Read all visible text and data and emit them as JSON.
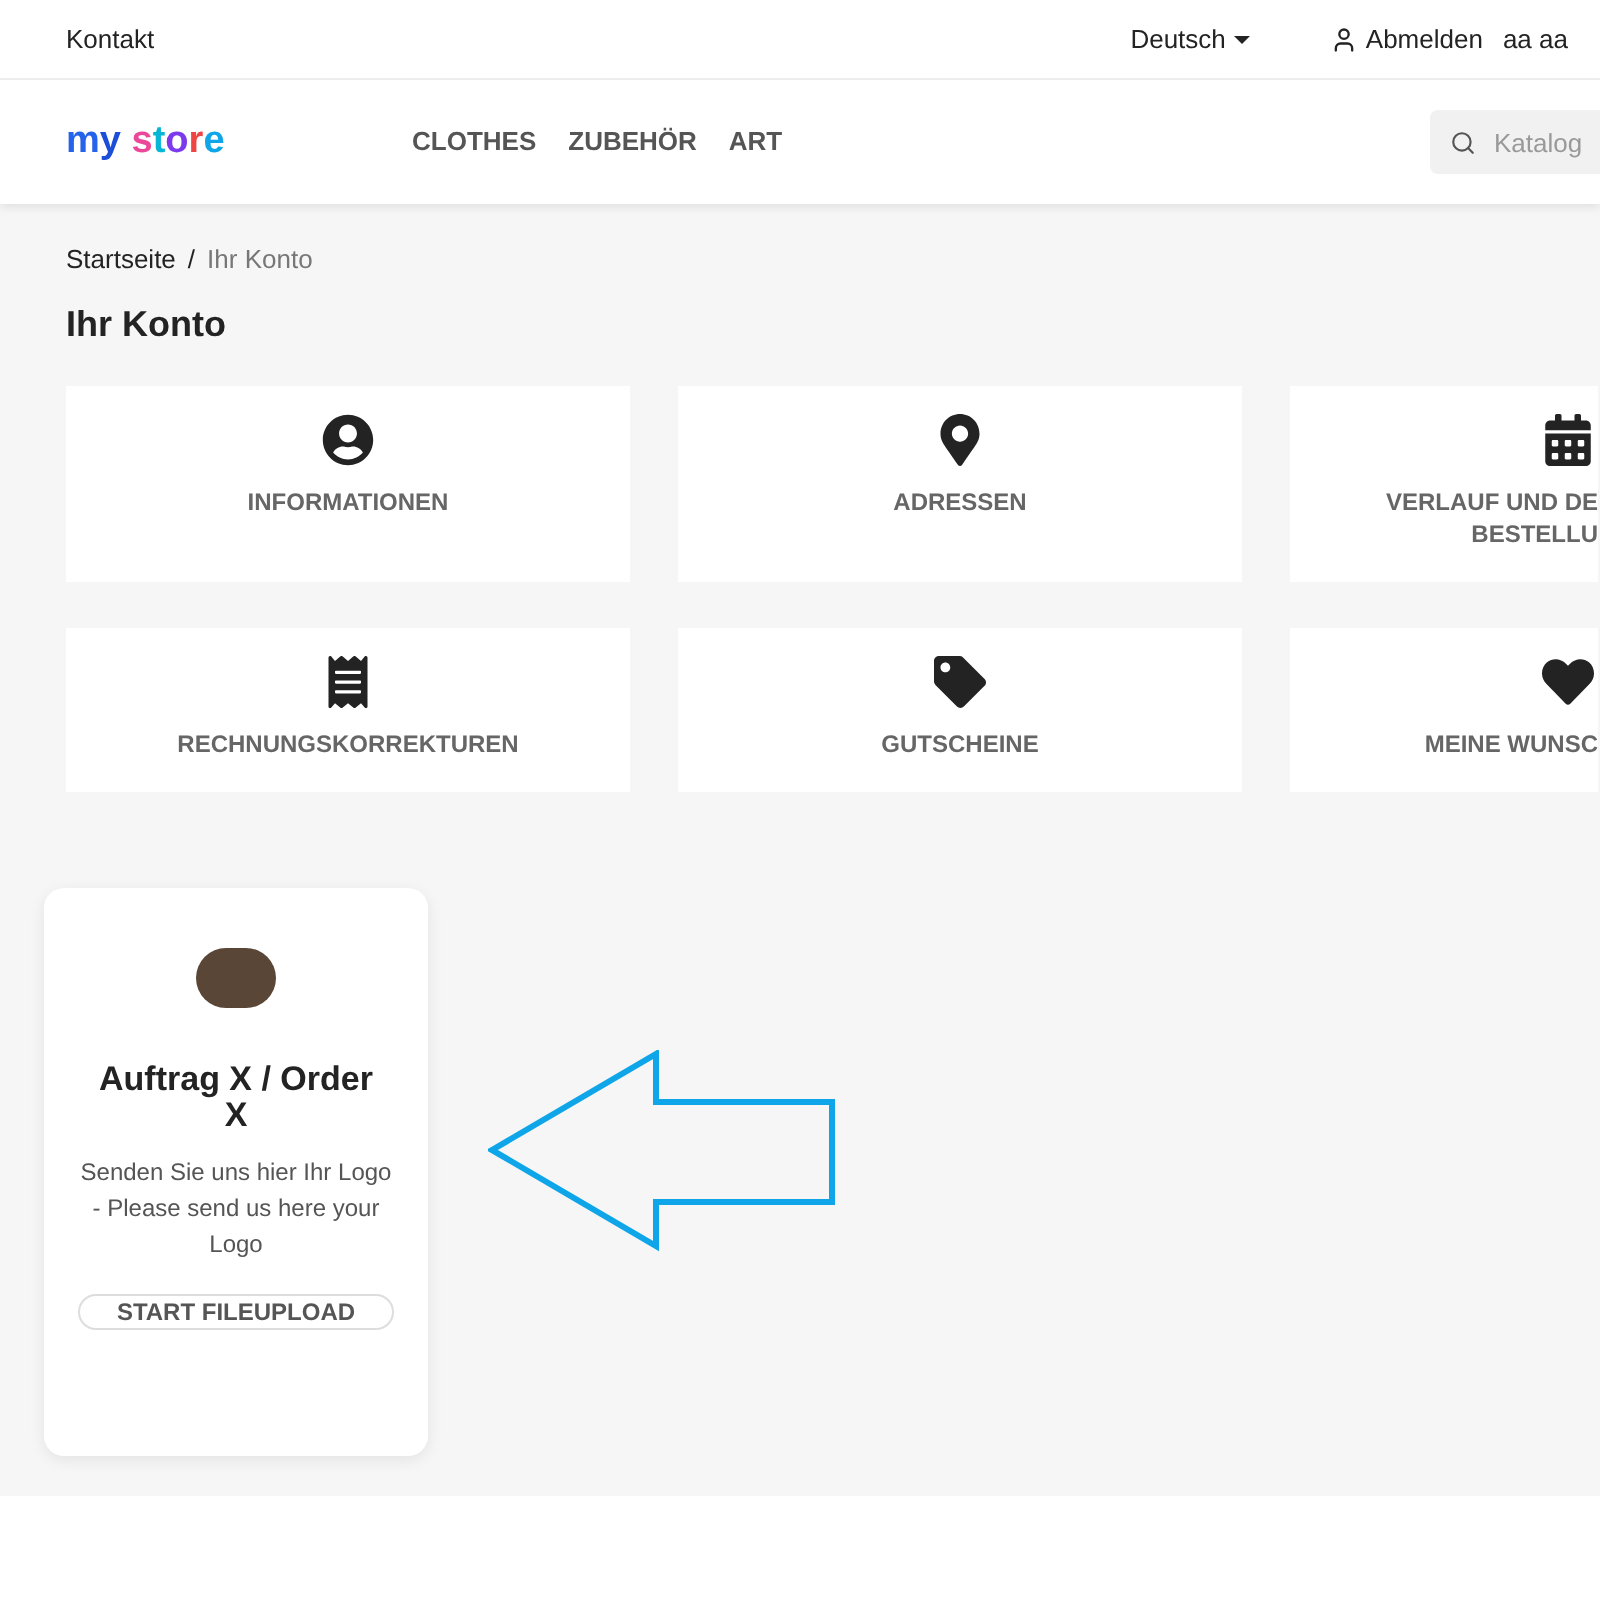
{
  "top_bar": {
    "contact": "Kontakt",
    "language": "Deutsch",
    "logout": "Abmelden",
    "user": "aa aa"
  },
  "header": {
    "logo": "my store",
    "nav": [
      "CLOTHES",
      "ZUBEHÖR",
      "ART"
    ],
    "search": {
      "placeholder": "Katalog"
    }
  },
  "breadcrumb": {
    "items": [
      "Startseite",
      "Ihr Konto"
    ],
    "separator": "/"
  },
  "title": "Ihr Konto",
  "tiles": [
    [
      {
        "kind": "user",
        "lines": [
          "INFORMATIONEN"
        ]
      },
      {
        "kind": "pin",
        "lines": [
          "ADRESSEN"
        ]
      },
      {
        "kind": "calendar",
        "lines": [
          "VERLAUF UND DE",
          "BESTELLU"
        ]
      }
    ],
    [
      {
        "kind": "receipt",
        "lines": [
          "RECHNUNGSKORREKTUREN"
        ]
      },
      {
        "kind": "tag",
        "lines": [
          "GUTSCHEINE"
        ]
      },
      {
        "kind": "heart",
        "lines": [
          "MEINE WUNSC"
        ]
      }
    ]
  ],
  "upload_card": {
    "title": "Auftrag X / Order X",
    "text": "Senden Sie uns hier Ihr Logo - Please send us here your Logo",
    "button": "START FILEUPLOAD"
  }
}
